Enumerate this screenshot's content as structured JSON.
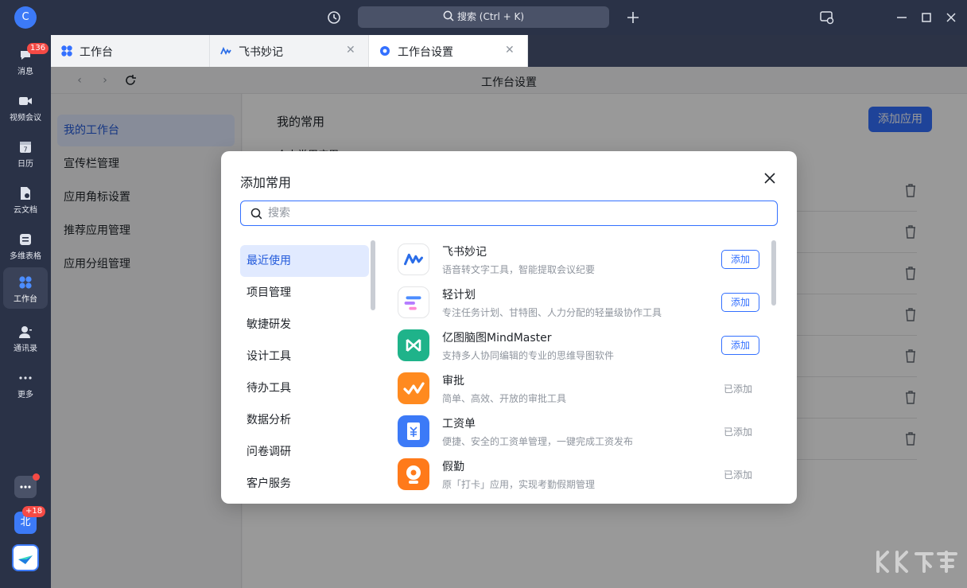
{
  "rail": {
    "avatar_letter": "C",
    "items": [
      {
        "label": "消息",
        "badge": "136"
      },
      {
        "label": "视频会议"
      },
      {
        "label": "日历",
        "icon_text": "7"
      },
      {
        "label": "云文档"
      },
      {
        "label": "多维表格"
      },
      {
        "label": "工作台"
      },
      {
        "label": "通讯录"
      },
      {
        "label": "更多"
      }
    ],
    "bottom_badge": "+18",
    "bottom_char": "北"
  },
  "titlebar": {
    "search_label": "搜索 (Ctrl + K)"
  },
  "tabs": [
    {
      "label": "工作台"
    },
    {
      "label": "飞书妙记"
    },
    {
      "label": "工作台设置"
    }
  ],
  "page": {
    "title": "工作台设置",
    "side_menu": [
      "我的工作台",
      "宣传栏管理",
      "应用角标设置",
      "推荐应用管理",
      "应用分组管理"
    ],
    "content_title": "我的常用",
    "content_sub": "个人常用应用",
    "add_app_label": "添加应用"
  },
  "modal": {
    "title": "添加常用",
    "search_placeholder": "搜索",
    "categories": [
      "最近使用",
      "项目管理",
      "敏捷研发",
      "设计工具",
      "待办工具",
      "数据分析",
      "问卷调研",
      "客户服务"
    ],
    "apps": [
      {
        "name": "飞书妙记",
        "desc": "语音转文字工具，智能提取会议纪要",
        "action": "添加",
        "added": false
      },
      {
        "name": "轻计划",
        "desc": "专注任务计划、甘特图、人力分配的轻量级协作工具",
        "action": "添加",
        "added": false
      },
      {
        "name": "亿图脑图MindMaster",
        "desc": "支持多人协同编辑的专业的思维导图软件",
        "action": "添加",
        "added": false
      },
      {
        "name": "审批",
        "desc": "简单、高效、开放的审批工具",
        "action": "已添加",
        "added": true
      },
      {
        "name": "工资单",
        "desc": "便捷、安全的工资单管理，一键完成工资发布",
        "action": "已添加",
        "added": true
      },
      {
        "name": "假勤",
        "desc": "原「打卡」应用，实现考勤假期管理",
        "action": "已添加",
        "added": true
      }
    ]
  },
  "colors": {
    "accent": "#3370ff",
    "rail_bg": "#2a3247",
    "badge": "#f54a45"
  }
}
